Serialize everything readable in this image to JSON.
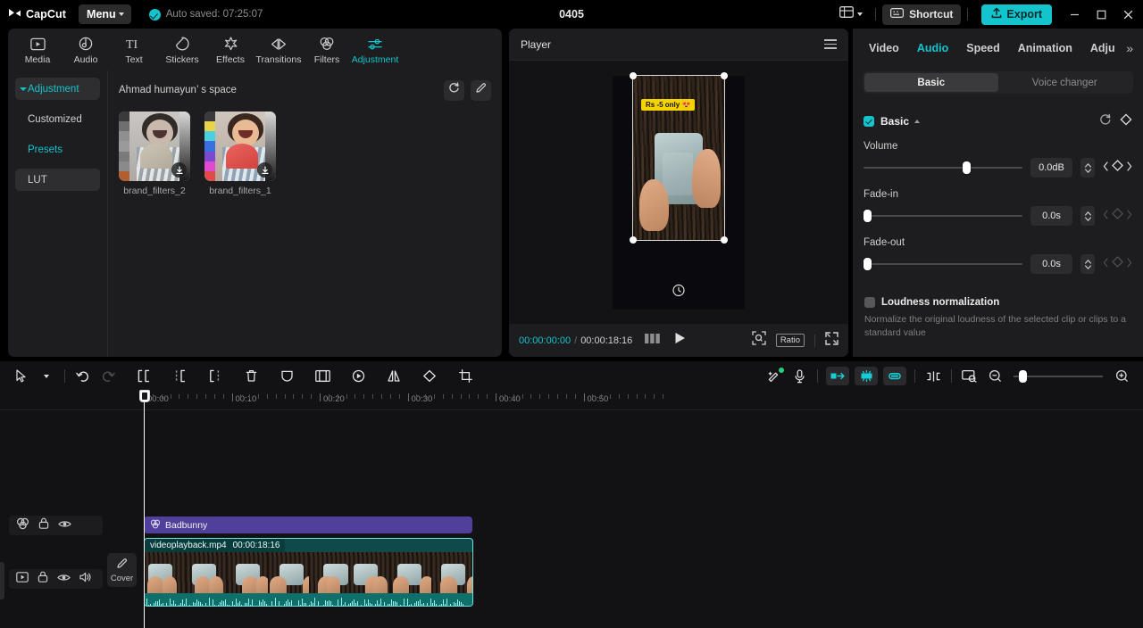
{
  "titlebar": {
    "brand": "CapCut",
    "menu_label": "Menu",
    "autosave_text": "Auto saved: 07:25:07",
    "project_title": "0405",
    "shortcut_label": "Shortcut",
    "export_label": "Export",
    "layout_icon": "layout-icon",
    "minimize": "–",
    "maximize": "☐",
    "close": "✕",
    "accent_color": "#13c4cc"
  },
  "toolbar": {
    "tabs": [
      {
        "label": "Media",
        "icon": "media-icon",
        "active": false
      },
      {
        "label": "Audio",
        "icon": "audio-icon",
        "active": false
      },
      {
        "label": "Text",
        "icon": "text-icon",
        "active": false
      },
      {
        "label": "Stickers",
        "icon": "stickers-icon",
        "active": false
      },
      {
        "label": "Effects",
        "icon": "effects-icon",
        "active": false
      },
      {
        "label": "Transitions",
        "icon": "transitions-icon",
        "active": false
      },
      {
        "label": "Filters",
        "icon": "filters-icon",
        "active": false
      },
      {
        "label": "Adjustment",
        "icon": "adjustment-icon",
        "active": true
      }
    ]
  },
  "sidenav": {
    "items": [
      {
        "label": "Adjustment",
        "selected": true,
        "cyan": true
      },
      {
        "label": "Customized",
        "selected": false,
        "cyan": false
      },
      {
        "label": "Presets",
        "selected": false,
        "cyan": true
      },
      {
        "label": "LUT",
        "selected": true,
        "cyan": false
      }
    ]
  },
  "library": {
    "space_title": "Ahmad humayun’ s space",
    "refresh_icon": "refresh-icon",
    "edit_icon": "pencil-icon",
    "items": [
      {
        "label": "brand_filters_2",
        "download_icon": "download-icon"
      },
      {
        "label": "brand_filters_1",
        "download_icon": "download-icon"
      }
    ]
  },
  "player": {
    "title": "Player",
    "menu_icon": "hamburger-icon",
    "overlay_text": "Rs -5 only 😍",
    "current_time": "00:00:00:00",
    "separator": "/",
    "total_time": "00:00:18:16",
    "frames_icon": "frames-icon",
    "play_icon": "play-icon",
    "zoom_icon": "zoom-fit-icon",
    "ratio_label": "Ratio",
    "fullscreen_icon": "fullscreen-icon"
  },
  "inspector": {
    "tabs": [
      {
        "label": "Video",
        "active": false
      },
      {
        "label": "Audio",
        "active": true
      },
      {
        "label": "Speed",
        "active": false
      },
      {
        "label": "Animation",
        "active": false
      },
      {
        "label": "Adju",
        "active": false
      }
    ],
    "more_icon": "chevron-right-double-icon",
    "segments": [
      {
        "label": "Basic",
        "on": true
      },
      {
        "label": "Voice changer",
        "on": false
      }
    ],
    "basic": {
      "title": "Basic",
      "checked": true,
      "reset_icon": "reset-icon",
      "keyframe_icon": "keyframe-icon",
      "controls": [
        {
          "label": "Volume",
          "value": "0.0dB",
          "knob_pct": 66
        },
        {
          "label": "Fade-in",
          "value": "0.0s",
          "knob_pct": 0
        },
        {
          "label": "Fade-out",
          "value": "0.0s",
          "knob_pct": 0
        }
      ]
    },
    "loudness": {
      "title": "Loudness normalization",
      "checked": false,
      "description": "Normalize the original loudness of the selected clip or clips to a standard value"
    }
  },
  "timeline": {
    "tools": [
      {
        "name": "select-tool",
        "icon": "cursor-icon"
      },
      {
        "name": "tool-dropdown",
        "icon": "chevron-down-icon"
      },
      {
        "name": "undo-button",
        "icon": "undo-icon"
      },
      {
        "name": "redo-button",
        "icon": "redo-icon"
      },
      {
        "name": "split-left-button",
        "icon": "split-left-icon"
      },
      {
        "name": "split-center-button",
        "icon": "split-center-icon"
      },
      {
        "name": "split-right-button",
        "icon": "split-right-icon"
      },
      {
        "name": "delete-button",
        "icon": "trash-icon"
      },
      {
        "name": "mask-button",
        "icon": "shield-icon"
      },
      {
        "name": "crop-frame-button",
        "icon": "frame-icon"
      },
      {
        "name": "speed-button",
        "icon": "speed-icon"
      },
      {
        "name": "mirror-button",
        "icon": "mirror-icon"
      },
      {
        "name": "rotate-button",
        "icon": "rotate-icon"
      },
      {
        "name": "crop-button",
        "icon": "crop-icon"
      }
    ],
    "right_tools": [
      {
        "name": "magic-tool-button",
        "icon": "magic-wand-icon",
        "badge": true
      },
      {
        "name": "record-button",
        "icon": "microphone-icon"
      },
      {
        "name": "keyframe-in-button",
        "icon": "keyframe-in-icon",
        "cyan": true
      },
      {
        "name": "keyframe-mid-button",
        "icon": "keyframe-mid-icon",
        "cyan": true
      },
      {
        "name": "keyframe-out-button",
        "icon": "keyframe-out-icon",
        "cyan": true
      },
      {
        "name": "split-clip-button",
        "icon": "split-clip-icon"
      },
      {
        "name": "preview-button",
        "icon": "preview-icon"
      },
      {
        "name": "zoom-out-button",
        "icon": "zoom-out-icon"
      },
      {
        "name": "zoom-in-button",
        "icon": "zoom-in-icon"
      }
    ],
    "zoom_knob_pct": 6,
    "ruler_labels": [
      "00:00",
      "00:10",
      "00:20",
      "00:30",
      "00:40",
      "00:50"
    ],
    "cover_label": "Cover",
    "cover_icon": "pencil-icon",
    "track_headers": [
      {
        "icons": [
          "filters-icon",
          "lock-icon",
          "eye-icon"
        ]
      },
      {
        "icons": [
          "video-icon",
          "lock-icon",
          "eye-icon",
          "speaker-icon"
        ]
      }
    ],
    "clips": {
      "audio": {
        "name": "Badbunny",
        "icon": "filters-icon",
        "color": "#51409b"
      },
      "video": {
        "name": "videoplayback.mp4",
        "duration": "00:00:18:16",
        "color": "#0f4a4a"
      }
    }
  }
}
